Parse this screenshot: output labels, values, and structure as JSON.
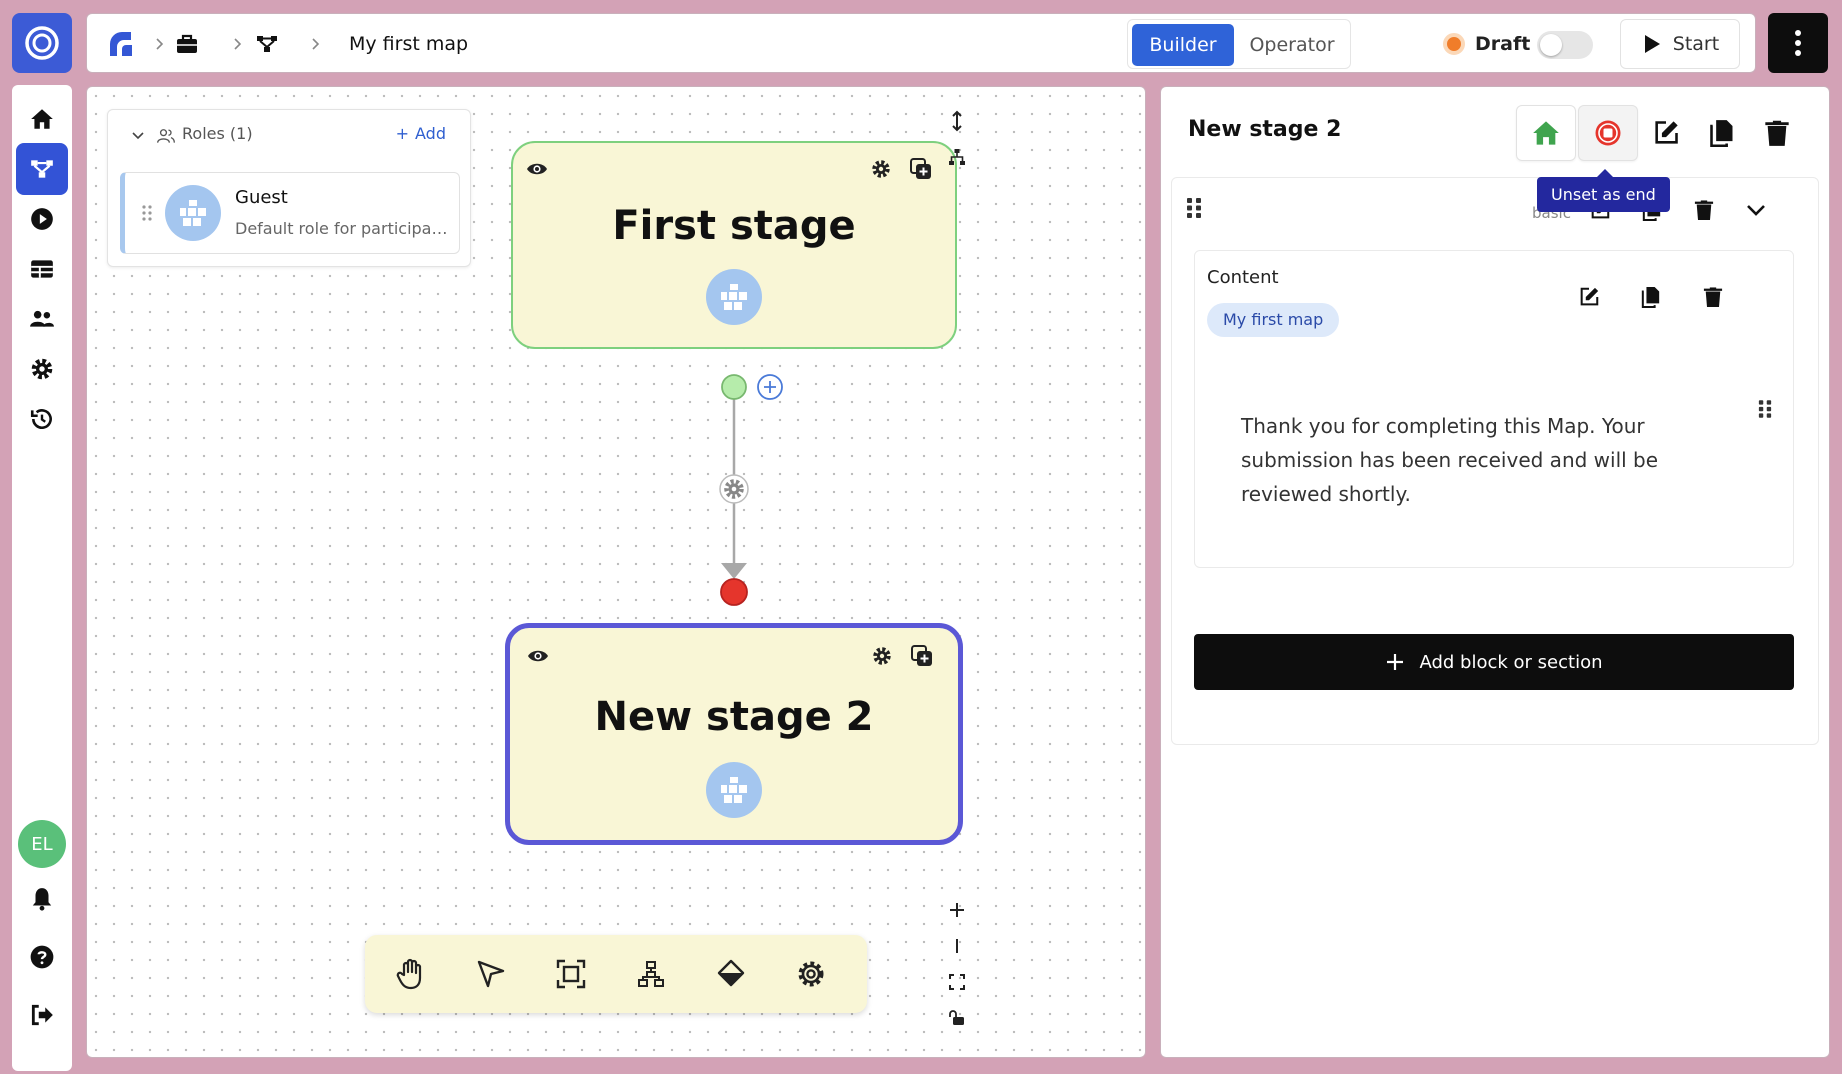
{
  "header": {
    "breadcrumb_title": "My first map",
    "mode_builder": "Builder",
    "mode_operator": "Operator",
    "status_label": "Draft",
    "start_label": "Start"
  },
  "sidebar": {
    "avatar_initials": "EL",
    "items": [
      "home-icon",
      "map-icon",
      "play-icon",
      "table-icon",
      "users-icon",
      "gear-icon",
      "history-icon"
    ]
  },
  "roles": {
    "title": "Roles (1)",
    "add_label": "Add",
    "items": [
      {
        "name": "Guest",
        "description": "Default role for participa…"
      }
    ]
  },
  "canvas": {
    "stages": [
      {
        "title": "First stage"
      },
      {
        "title": "New stage 2"
      }
    ]
  },
  "panel": {
    "title": "New stage 2",
    "tooltip": "Unset as end",
    "section_type": "basic",
    "content_label": "Content",
    "content_chip": "My first map",
    "content_text": "Thank you for completing this Map. Your submission has been received and will be reviewed shortly.",
    "add_block_label": "Add block or section"
  },
  "colors": {
    "accent": "#2f63d8",
    "stage_fill": "#f9f6d6",
    "start_node": "#b6ecab",
    "end_node": "#e5352c",
    "selected_border": "#5b58d6"
  }
}
